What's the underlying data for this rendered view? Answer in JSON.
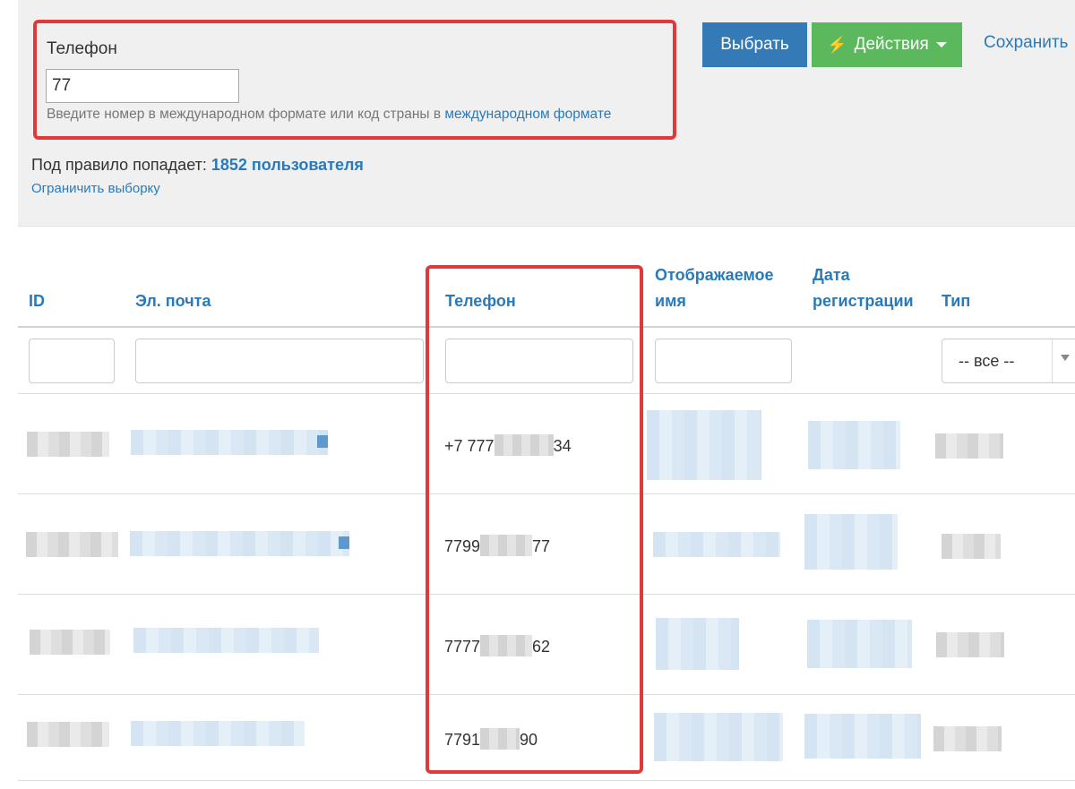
{
  "filter": {
    "field_label": "Телефон",
    "phone_value": "77",
    "hint_text": "Введите номер в международном формате или код страны в ",
    "hint_link": "международном формате"
  },
  "toolbar": {
    "select_label": "Выбрать",
    "actions_label": "Действия",
    "actions_icon": "bolt-icon",
    "save_label": "Сохранить"
  },
  "summary": {
    "prefix": "Под правило попадает: ",
    "count_text": "1852 пользователя",
    "limit_link": "Ограничить выборку"
  },
  "table": {
    "columns": {
      "id": "ID",
      "email": "Эл. почта",
      "phone": "Телефон",
      "display_name_1": "Отображаемое",
      "display_name_2": "имя",
      "reg_date_1": "Дата",
      "reg_date_2": "регистрации",
      "type": "Тип"
    },
    "type_filter_value": "-- все --",
    "rows": [
      {
        "phone_start": "+7 777",
        "phone_end": "34"
      },
      {
        "phone_start": "7799",
        "phone_end": "77"
      },
      {
        "phone_start": "7777",
        "phone_end": "62"
      },
      {
        "phone_start": "7791",
        "phone_end": "90"
      }
    ]
  },
  "colors": {
    "highlight": "#e0393a",
    "link": "#2a7ab9",
    "primary_button": "#337ab7",
    "success_button": "#5cb85c",
    "panel_bg": "#f0f0f0"
  }
}
